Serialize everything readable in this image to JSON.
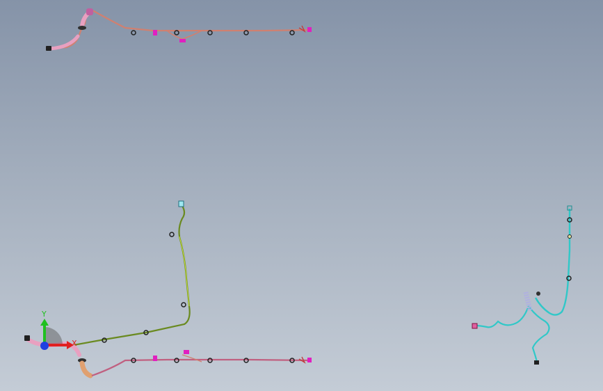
{
  "viewport": {
    "background_top": "#8593a8",
    "background_bottom": "#c4ccd6"
  },
  "triad": {
    "x_label": "X",
    "y_label": "Y",
    "x_color": "#e02020",
    "y_color": "#20c020",
    "z_color": "#2040e0"
  },
  "harness_colors": {
    "pink": "#e8a0c0",
    "pink_dark": "#c06080",
    "salmon": "#d08070",
    "green": "#6a8a20",
    "green_light": "#c8e040",
    "cyan": "#30c8c8",
    "cyan_dark": "#1a9090",
    "magenta": "#e020c0",
    "connector": "#202020",
    "orange": "#e0a070"
  },
  "icons": {
    "triad": "coordinate-triad-icon"
  }
}
